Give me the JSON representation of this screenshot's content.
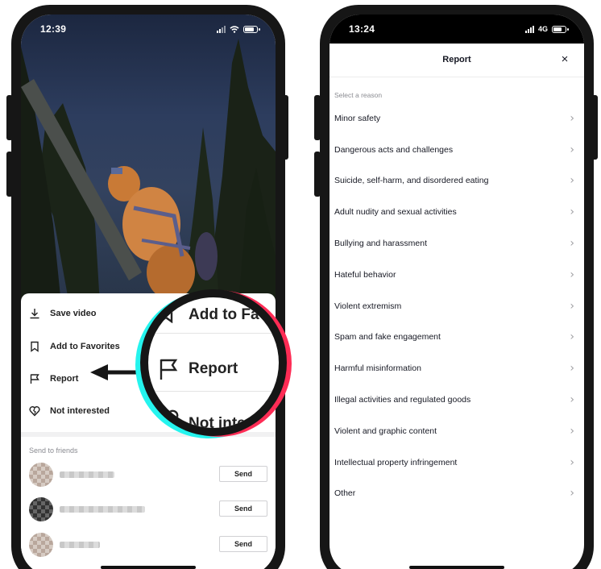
{
  "left_phone": {
    "status_time": "12:39",
    "sheet_items": [
      {
        "label": "Save video",
        "icon": "download-icon"
      },
      {
        "label": "Add to Favorites",
        "icon": "bookmark-icon"
      },
      {
        "label": "Report",
        "icon": "flag-icon"
      },
      {
        "label": "Not interested",
        "icon": "broken-heart-icon"
      }
    ],
    "friends_title": "Send to friends",
    "send_label": "Send"
  },
  "magnifier": {
    "item_top": "Add to Fa",
    "item_middle": "Report",
    "item_bottom": "Not intere"
  },
  "right_phone": {
    "status_time": "13:24",
    "network_label": "4G",
    "title": "Report",
    "close_glyph": "×",
    "select_label": "Select a reason",
    "reasons": [
      "Minor safety",
      "Dangerous acts and challenges",
      "Suicide, self-harm, and disordered eating",
      "Adult nudity and sexual activities",
      "Bullying and harassment",
      "Hateful behavior",
      "Violent extremism",
      "Spam and fake engagement",
      "Harmful misinformation",
      "Illegal activities and regulated goods",
      "Violent and graphic content",
      "Intellectual property infringement",
      "Other"
    ],
    "chevron_glyph": "›"
  },
  "colors": {
    "brand_cyan": "#25f4ee",
    "brand_pink": "#fe2c55",
    "text_primary": "#161823",
    "text_secondary": "#8a8b91"
  }
}
